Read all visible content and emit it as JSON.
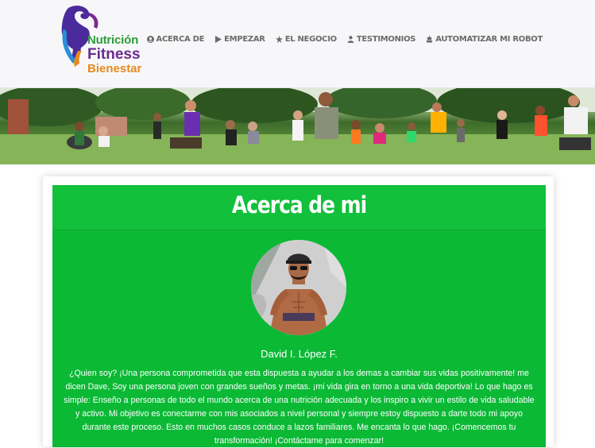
{
  "brand": {
    "line1_a": "Nutri",
    "line1_b": "ción",
    "line2": "Fitness",
    "line3": "Bienestar"
  },
  "nav": [
    {
      "label": "ACERCA DE",
      "icon": "user-circle-icon"
    },
    {
      "label": "EMPEZAR",
      "icon": "play-icon"
    },
    {
      "label": "EL NEGOCIO",
      "icon": "star-icon"
    },
    {
      "label": "TESTIMONIOS",
      "icon": "person-icon"
    },
    {
      "label": "AUTOMATIZAR MI ROBOT",
      "icon": "robot-icon"
    }
  ],
  "about": {
    "title": "Acerca de mi",
    "name": "David I. López F.",
    "bio": "¿Quien soy? ¡Una persona comprometida que esta dispuesta a ayudar a los demas a cambiar sus vidas positivamente! me dicen Dave, Soy una persona joven con grandes sueños y metas. ¡mi vida gira en torno a una vida deportiva! Lo que hago es simple: Enseño a personas de todo el mundo acerca de una nutrición adecuada y los inspiro a vivir un estilo de vida saludable y activo. Mi objetivo es conectarme con mis asociados a nivel personal y siempre estoy dispuesto a darte todo mi apoyo durante este proceso. Esto en muchos casos conduce a lazos familiares. Me encanta lo que hago. ¡Comencemos tu transformación! ¡Contáctame para comenzar!"
  },
  "colors": {
    "accent_green": "#0bb935",
    "brand_purple": "#6a2b8e",
    "brand_orange": "#e78a1e",
    "nav_text": "#6b6b6b"
  }
}
